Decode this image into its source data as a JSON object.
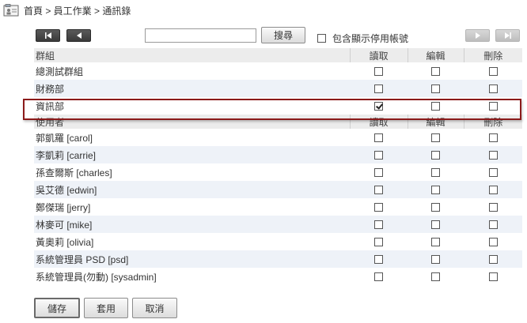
{
  "breadcrumb": "首頁 > 員工作業 > 通訊錄",
  "toolbar": {
    "search_value": "",
    "search_button": "搜尋",
    "include_disabled_label": "包含顯示停用帳號"
  },
  "group_header": {
    "name": "群組",
    "read": "讀取",
    "edit": "編輯",
    "delete": "刪除"
  },
  "groups": [
    {
      "name": "總測試群組",
      "read": false,
      "edit": false,
      "delete": false
    },
    {
      "name": "財務部",
      "read": false,
      "edit": false,
      "delete": false
    },
    {
      "name": "資訊部",
      "read": true,
      "edit": false,
      "delete": false
    }
  ],
  "user_header": {
    "name": "使用者",
    "read": "讀取",
    "edit": "編輯",
    "delete": "刪除"
  },
  "users": [
    {
      "name": "郭凱羅 [carol]",
      "read": false,
      "edit": false,
      "delete": false
    },
    {
      "name": "李凱莉 [carrie]",
      "read": false,
      "edit": false,
      "delete": false
    },
    {
      "name": "孫查爾斯 [charles]",
      "read": false,
      "edit": false,
      "delete": false
    },
    {
      "name": "吳艾德 [edwin]",
      "read": false,
      "edit": false,
      "delete": false
    },
    {
      "name": "鄭傑瑞 [jerry]",
      "read": false,
      "edit": false,
      "delete": false
    },
    {
      "name": "林麥可 [mike]",
      "read": false,
      "edit": false,
      "delete": false
    },
    {
      "name": "黃奧莉 [olivia]",
      "read": false,
      "edit": false,
      "delete": false
    },
    {
      "name": "系統管理員 PSD [psd]",
      "read": false,
      "edit": false,
      "delete": false
    },
    {
      "name": "系統管理員(勿動) [sysadmin]",
      "read": false,
      "edit": false,
      "delete": false
    }
  ],
  "actions": {
    "save": "儲存",
    "apply": "套用",
    "cancel": "取消"
  }
}
